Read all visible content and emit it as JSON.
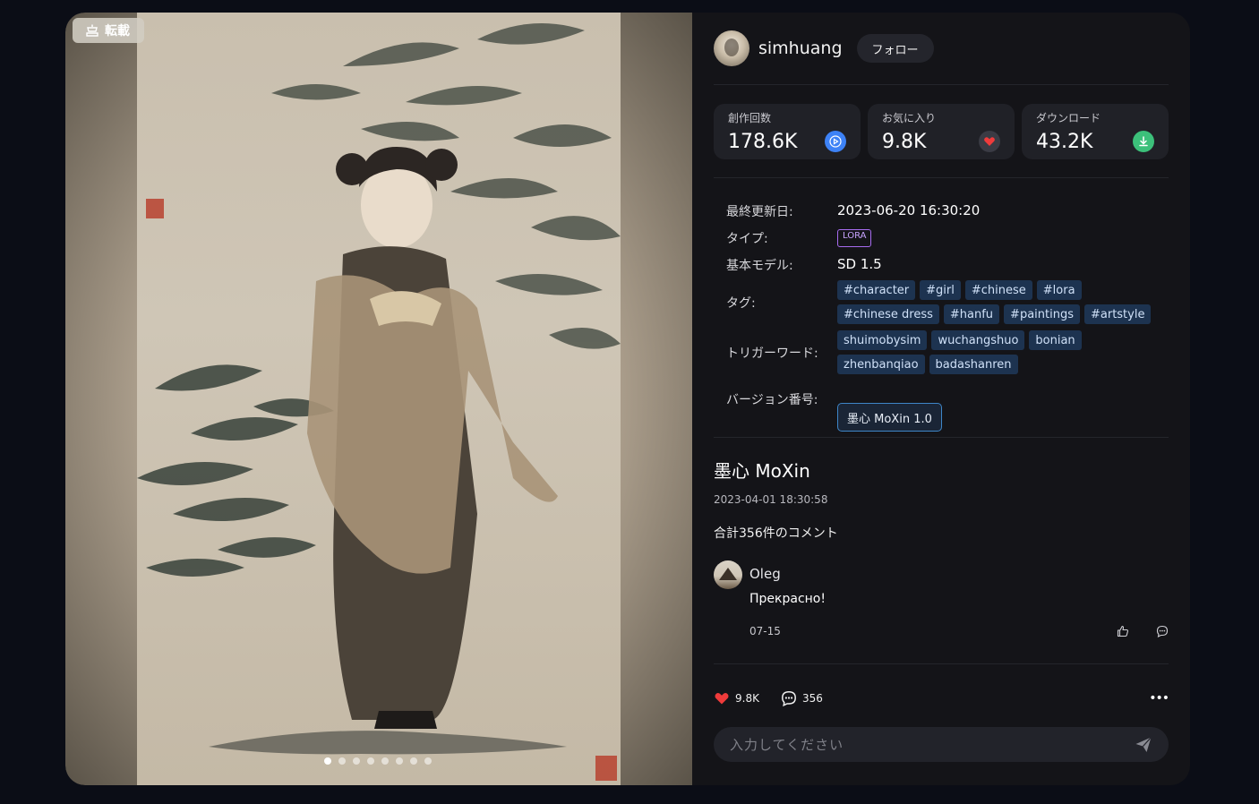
{
  "image": {
    "repost_label": "転載",
    "carousel_count": 8,
    "active_index": 0
  },
  "author": {
    "name": "simhuang",
    "follow_label": "フォロー"
  },
  "stats": [
    {
      "label": "創作回数",
      "value": "178.6K",
      "icon": "play-icon",
      "color": "#3d82f6"
    },
    {
      "label": "お気に入り",
      "value": "9.8K",
      "icon": "heart-icon",
      "color": "#ef3b3b"
    },
    {
      "label": "ダウンロード",
      "value": "43.2K",
      "icon": "download-icon",
      "color": "#3cc07a"
    }
  ],
  "meta": {
    "updated_label": "最終更新日:",
    "updated_value": "2023-06-20 16:30:20",
    "type_label": "タイプ:",
    "type_value": "LORA",
    "base_label": "基本モデル:",
    "base_value": "SD 1.5",
    "tags_label": "タグ:",
    "tags": [
      "#character",
      "#girl",
      "#chinese",
      "#lora",
      "#chinese dress",
      "#hanfu",
      "#paintings",
      "#artstyle"
    ],
    "trigger_label": "トリガーワード:",
    "triggers": [
      "shuimobysim",
      "wuchangshuo",
      "bonian",
      "zhenbanqiao",
      "badashanren"
    ],
    "version_label": "バージョン番号:",
    "version_value": "墨心 MoXin 1.0"
  },
  "model": {
    "title": "墨心 MoXin",
    "date": "2023-04-01 18:30:58",
    "comment_count_text": "合計356件のコメント"
  },
  "comment": {
    "author": "Oleg",
    "text": "Прекрасно!",
    "date": "07-15"
  },
  "actions": {
    "likes": "9.8K",
    "comments": "356",
    "more": "•••"
  },
  "input": {
    "placeholder": "入力してください"
  }
}
